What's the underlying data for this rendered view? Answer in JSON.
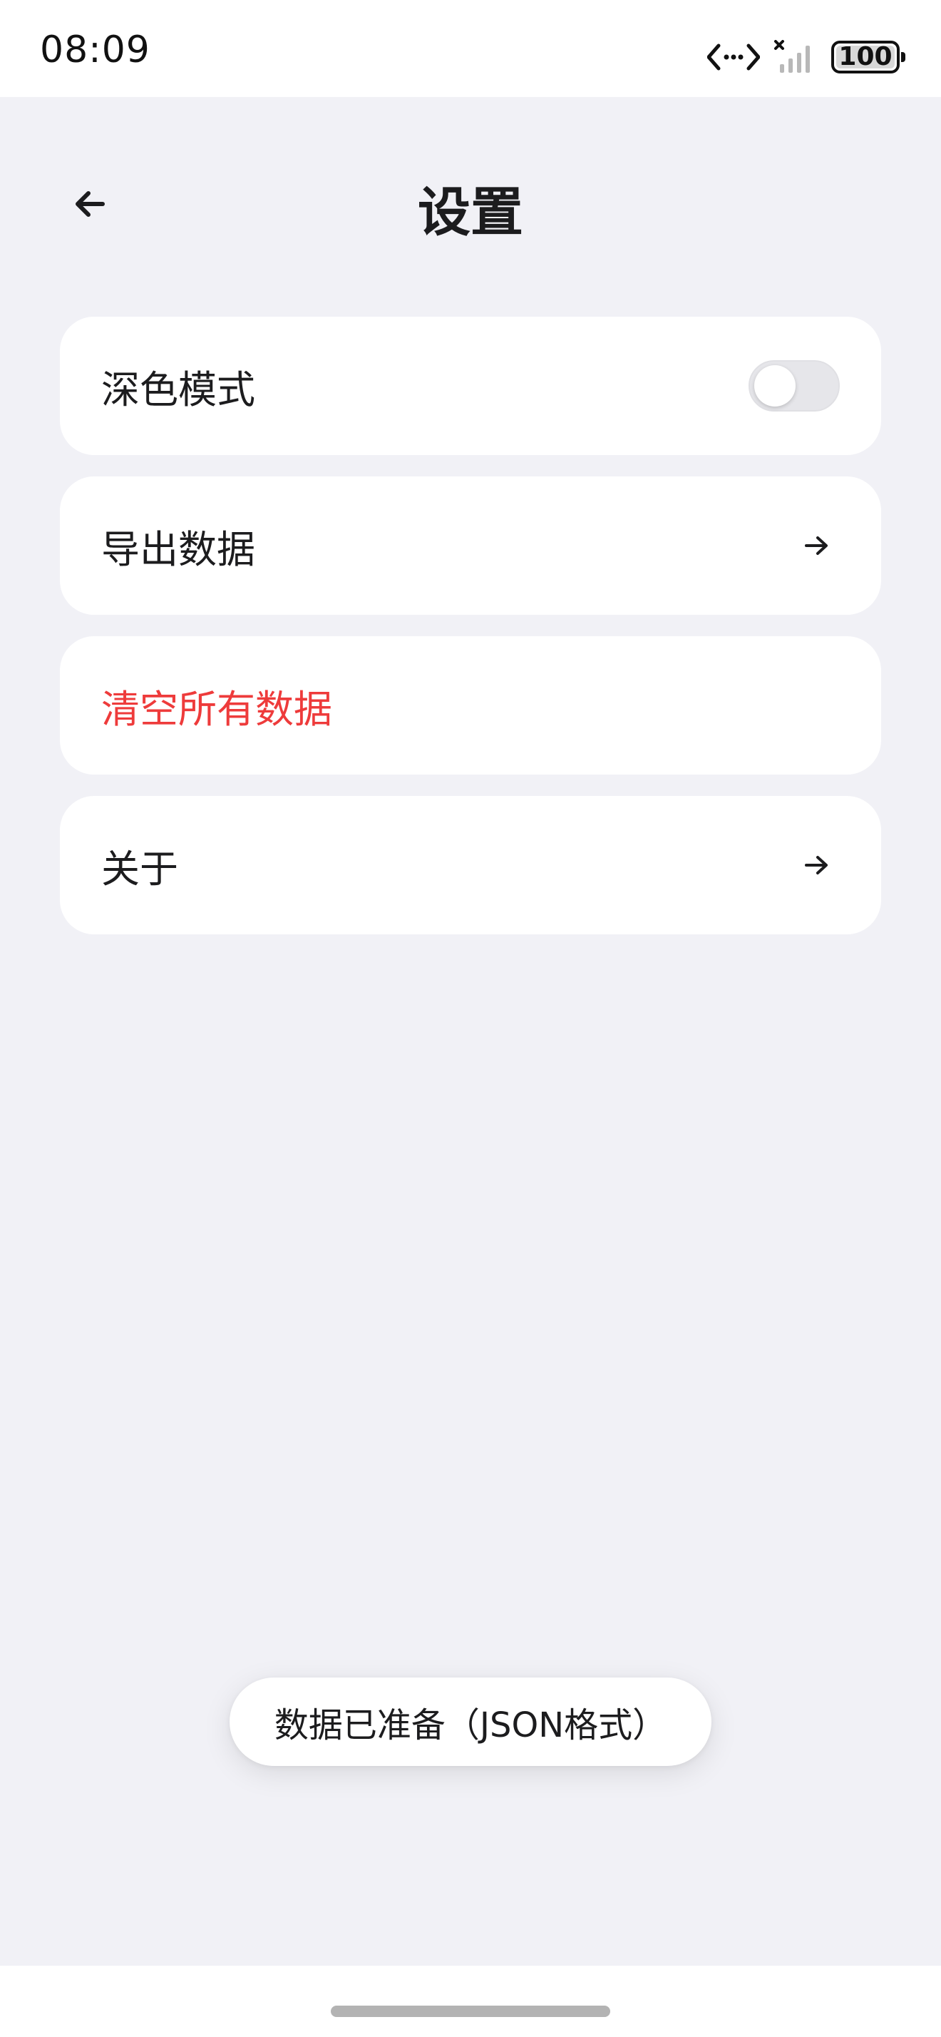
{
  "status_bar": {
    "time": "08:09",
    "battery_level": "100",
    "icons": [
      "data-transfer-icon",
      "signal-no-service-icon",
      "battery-icon"
    ]
  },
  "header": {
    "back_icon": "arrow-left-icon",
    "title": "设置"
  },
  "settings": {
    "items": [
      {
        "label": "深色模式",
        "control": "toggle",
        "toggle_on": false
      },
      {
        "label": "导出数据",
        "control": "arrow-right-icon"
      },
      {
        "label": "清空所有数据",
        "control": "none",
        "danger": true
      },
      {
        "label": "关于",
        "control": "arrow-right-icon"
      }
    ]
  },
  "toast": {
    "message": "数据已准备（JSON格式）"
  },
  "colors": {
    "background": "#f1f1f6",
    "card": "#ffffff",
    "text": "#1c1c1e",
    "danger": "#ee3b3b",
    "toggle_off": "#e6e6ea"
  }
}
